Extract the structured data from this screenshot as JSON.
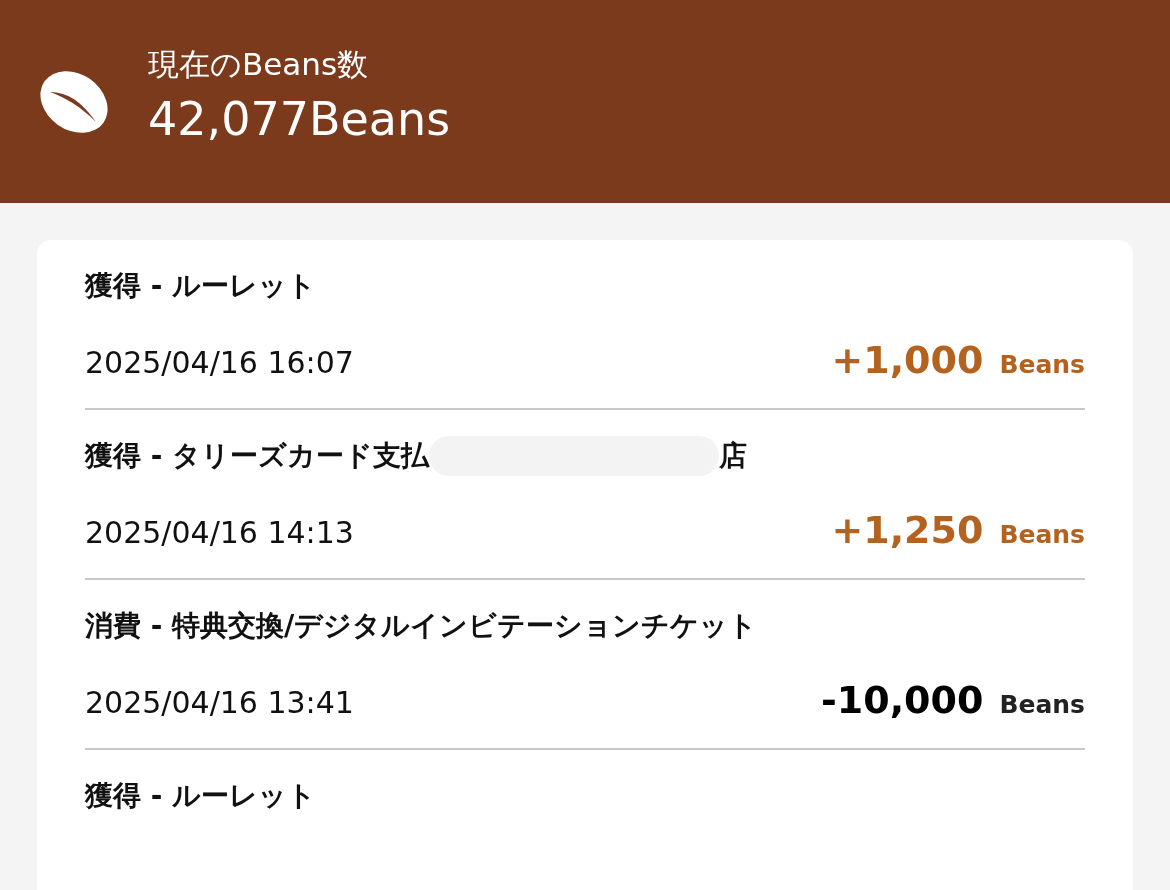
{
  "header": {
    "label": "現在のBeans数",
    "balance": "42,077Beans"
  },
  "history": [
    {
      "title": "獲得 - ルーレット",
      "date": "2025/04/16 16:07",
      "amount": "+1,000",
      "unit": "Beans",
      "kind": "earn"
    },
    {
      "title": "獲得 - タリーズカード支払",
      "redacted": true,
      "title_end": "店",
      "date": "2025/04/16 14:13",
      "amount": "+1,250",
      "unit": "Beans",
      "kind": "earn"
    },
    {
      "title": "消費 - 特典交換/デジタルインビテーションチケット",
      "date": "2025/04/16 13:41",
      "amount": "-10,000",
      "unit": "Beans",
      "kind": "spend"
    },
    {
      "title": "獲得 - ルーレット"
    }
  ]
}
